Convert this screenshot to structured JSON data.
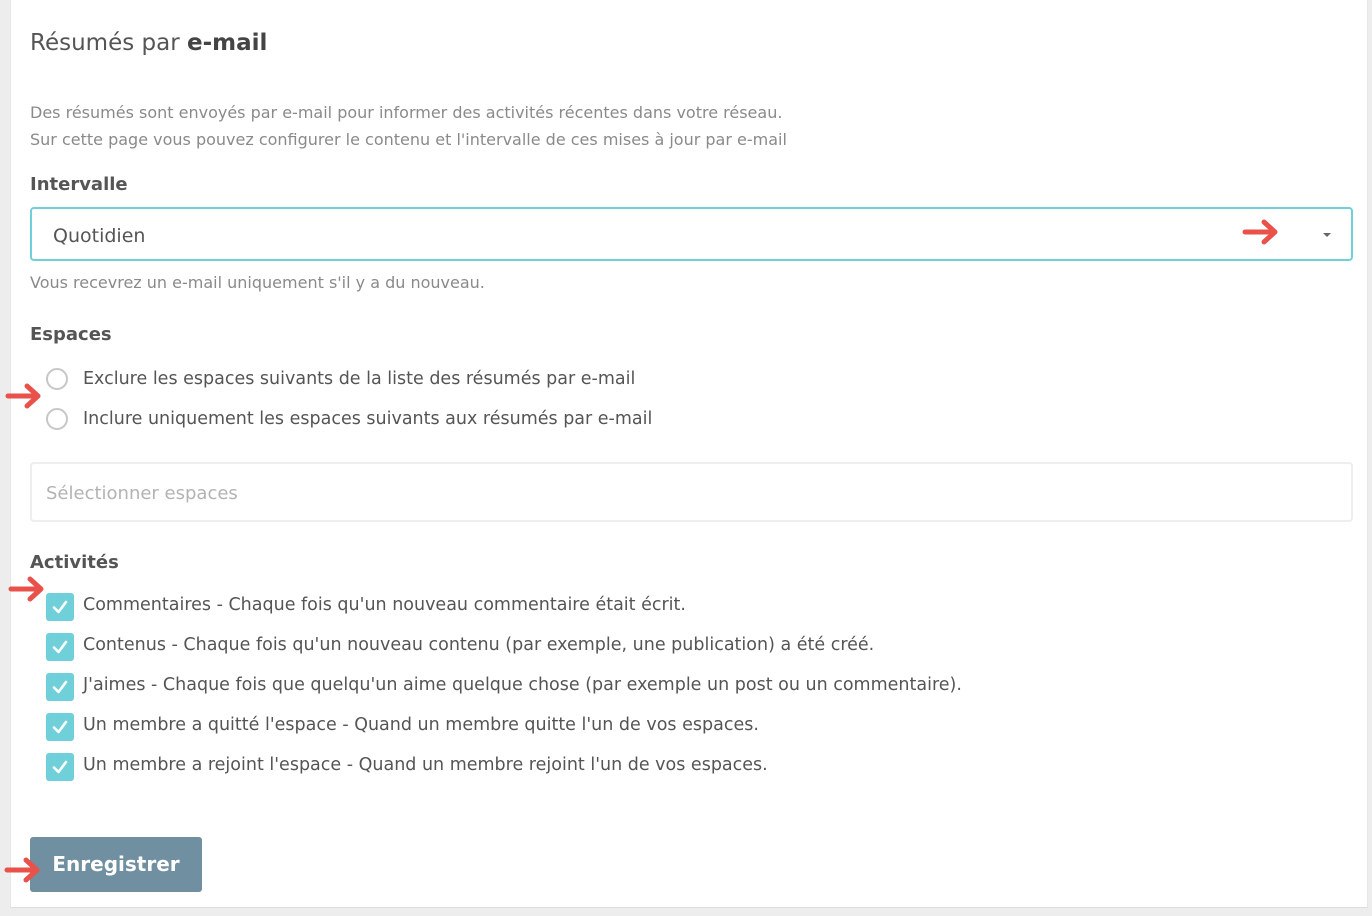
{
  "page": {
    "title_prefix": "Résumés par ",
    "title_bold": "e-mail",
    "description_line1": "Des résumés sont envoyés par e-mail pour informer des activités récentes dans votre réseau.",
    "description_line2": "Sur cette page vous pouvez configurer le contenu et l'intervalle de ces mises à jour par e-mail"
  },
  "interval": {
    "label": "Intervalle",
    "value": "Quotidien",
    "hint": "Vous recevrez un e-mail uniquement s'il y a du nouveau."
  },
  "spaces": {
    "label": "Espaces",
    "options": [
      {
        "label": "Exclure les espaces suivants de la liste des résumés par e-mail",
        "selected": false
      },
      {
        "label": "Inclure uniquement les espaces suivants aux résumés par e-mail",
        "selected": false
      }
    ],
    "placeholder": "Sélectionner espaces"
  },
  "activities": {
    "label": "Activités",
    "items": [
      {
        "label": "Commentaires - Chaque fois qu'un nouveau commentaire était écrit.",
        "checked": true
      },
      {
        "label": "Contenus - Chaque fois qu'un nouveau contenu (par exemple, une publication) a été créé.",
        "checked": true
      },
      {
        "label": "J'aimes - Chaque fois que quelqu'un aime quelque chose (par exemple un post ou un commentaire).",
        "checked": true
      },
      {
        "label": "Un membre a quitté l'espace - Quand un membre quitte l'un de vos espaces.",
        "checked": true
      },
      {
        "label": "Un membre a rejoint l'espace - Quand un membre rejoint l'un de vos espaces.",
        "checked": true
      }
    ]
  },
  "actions": {
    "save_label": "Enregistrer"
  },
  "colors": {
    "accent": "#6fd0da",
    "button": "#708fa0",
    "arrow": "#e8524a"
  }
}
